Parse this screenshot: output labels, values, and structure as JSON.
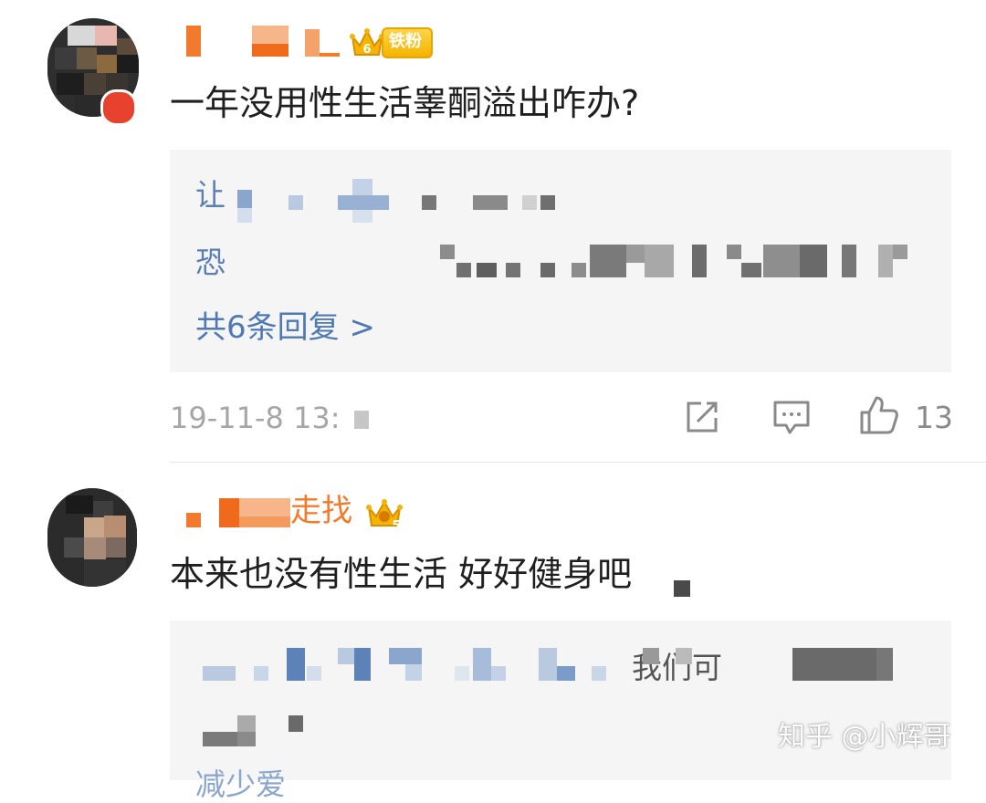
{
  "comments": [
    {
      "username_fragment": "",
      "badge": {
        "level": "6",
        "label": "铁粉"
      },
      "text": "一年没用性生活睾酮溢出咋办?",
      "replies": [
        {
          "visible_prefix": "让"
        },
        {
          "visible_prefix": "恐"
        }
      ],
      "more_replies": "共6条回复 >",
      "timestamp": "19-11-8 13:",
      "like_count": "13"
    },
    {
      "username_fragment": "走找",
      "badge": {
        "level": "5",
        "label": ""
      },
      "text": "本来也没有性生活 好好健身吧",
      "replies": [
        {
          "visible_fragment": "我们可"
        },
        {
          "visible_fragment": ""
        },
        {
          "visible_prefix": "减少爱"
        }
      ]
    }
  ],
  "watermark": "知乎 @小辉哥",
  "icons": {
    "repost": "share-icon",
    "comment": "comment-icon",
    "like": "thumbs-up-icon",
    "crown": "crown-icon"
  },
  "colors": {
    "reply_link": "#4f79b5",
    "badge_gold": "#f2b400",
    "username_orange": "#f47a2a",
    "meta_gray": "#a6a6a6"
  }
}
